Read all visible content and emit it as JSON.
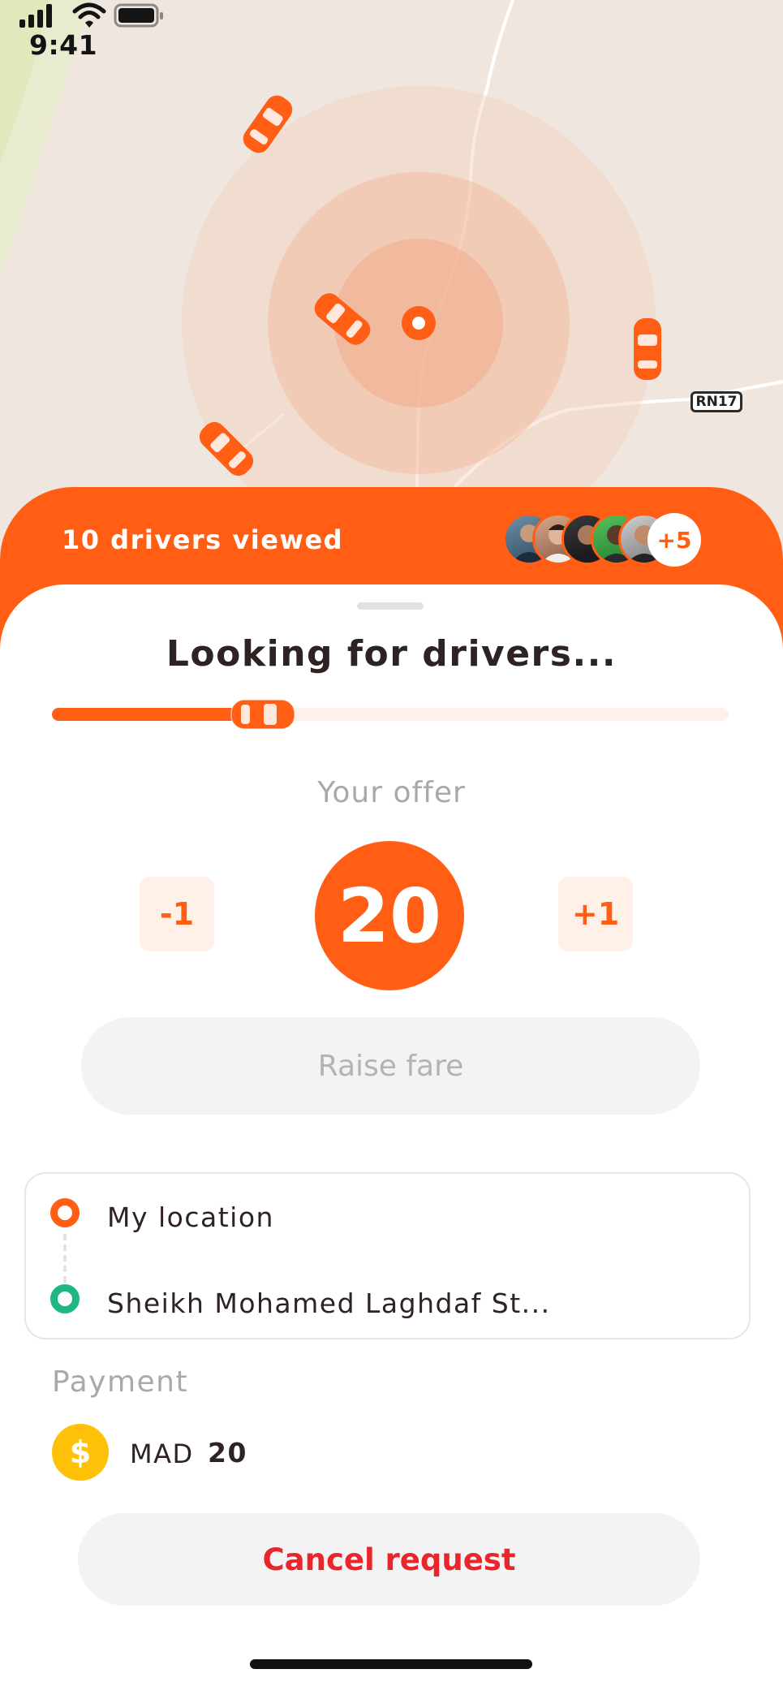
{
  "status_bar": {
    "time": "9:41"
  },
  "map": {
    "road_sign": "RN17",
    "car_icon": "car-icon",
    "pin_icon": "location-pin-icon"
  },
  "drivers": {
    "viewed_label": "10 drivers viewed",
    "more_count": "+5"
  },
  "search": {
    "title": "Looking for drivers...",
    "progress": 0.33
  },
  "offer": {
    "label": "Your offer",
    "decrease_label": "-1",
    "value": "20",
    "increase_label": "+1",
    "raise_label": "Raise fare"
  },
  "route": {
    "origin": "My location",
    "destination": "Sheikh Mohamed Laghdaf St..."
  },
  "payment": {
    "label": "Payment",
    "currency": "MAD",
    "amount": "20",
    "icon": "dollar-coin-icon"
  },
  "actions": {
    "cancel_label": "Cancel request"
  },
  "colors": {
    "accent": "#ff5e14",
    "accent_light": "#fff0e8",
    "cancel": "#e8262b",
    "destination": "#1fb784",
    "coin": "#ffc107"
  }
}
